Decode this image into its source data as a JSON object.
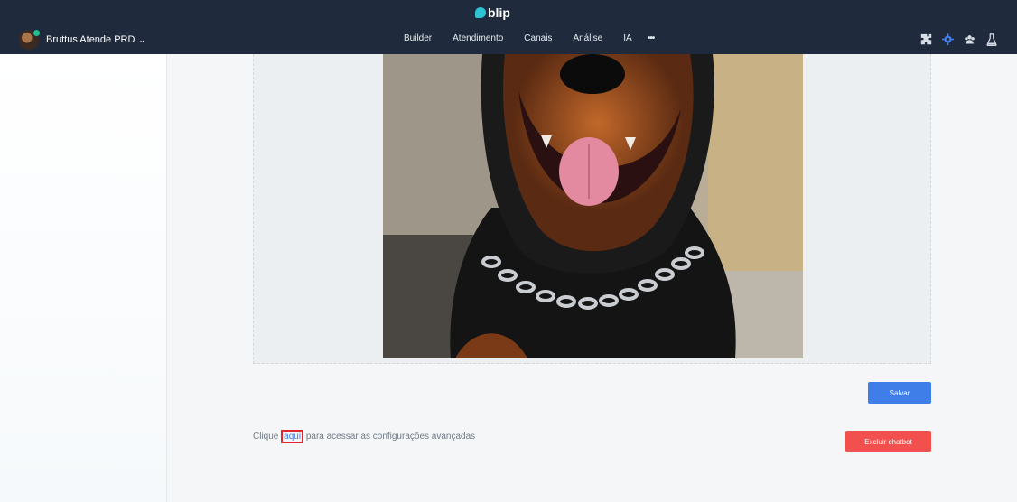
{
  "header": {
    "logo_text": "blip",
    "bot_name": "Bruttus Atende PRD",
    "nav": [
      {
        "label": "Builder"
      },
      {
        "label": "Atendimento"
      },
      {
        "label": "Canais"
      },
      {
        "label": "Análise"
      },
      {
        "label": "IA"
      }
    ],
    "more_label": "•••",
    "right_icons": [
      "puzzle-icon",
      "gear-icon",
      "team-icon",
      "flask-icon"
    ],
    "accent_color": "#2cc3d5",
    "bar_color": "#1f2b3d"
  },
  "main": {
    "save_label": "Salvar",
    "delete_label": "Excluir chatbot",
    "advanced_prefix": "Clique ",
    "advanced_link": "aqui",
    "advanced_suffix": " para acessar as configurações avançadas",
    "save_color": "#3f7de8",
    "delete_color": "#f2504e"
  }
}
